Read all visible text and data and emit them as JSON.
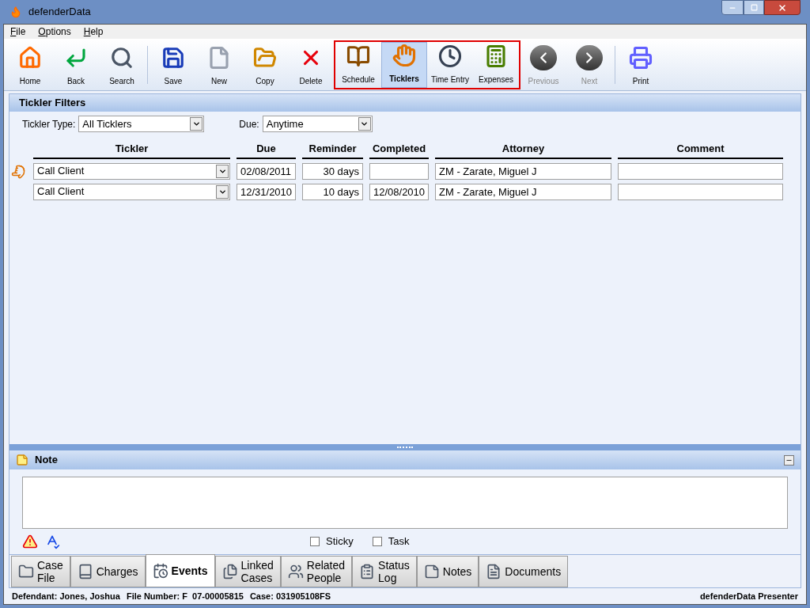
{
  "window": {
    "title": "defenderData"
  },
  "menu": [
    {
      "label": "File"
    },
    {
      "label": "Options"
    },
    {
      "label": "Help"
    }
  ],
  "toolbar": [
    {
      "highlighted": false,
      "divider_after": true,
      "buttons": [
        {
          "label": "Home",
          "selected": false,
          "disabled": false
        },
        {
          "label": "Back",
          "selected": false,
          "disabled": false
        },
        {
          "label": "Search",
          "selected": false,
          "disabled": false
        }
      ]
    },
    {
      "highlighted": false,
      "divider_after": false,
      "buttons": [
        {
          "label": "Save",
          "selected": false,
          "disabled": false
        },
        {
          "label": "New",
          "selected": false,
          "disabled": false
        },
        {
          "label": "Copy",
          "selected": false,
          "disabled": false
        },
        {
          "label": "Delete",
          "selected": false,
          "disabled": false
        }
      ]
    },
    {
      "highlighted": true,
      "divider_after": false,
      "buttons": [
        {
          "label": "Schedule",
          "selected": false,
          "disabled": false
        },
        {
          "label": "Ticklers",
          "selected": true,
          "disabled": false
        },
        {
          "label": "Time Entry",
          "selected": false,
          "disabled": false
        },
        {
          "label": "Expenses",
          "selected": false,
          "disabled": false
        }
      ]
    },
    {
      "highlighted": false,
      "divider_after": true,
      "buttons": [
        {
          "label": "Previous",
          "selected": false,
          "disabled": true
        },
        {
          "label": "Next",
          "selected": false,
          "disabled": true
        }
      ]
    },
    {
      "highlighted": false,
      "divider_after": false,
      "buttons": [
        {
          "label": "Print",
          "selected": false,
          "disabled": false
        }
      ]
    }
  ],
  "filters": {
    "title": "Tickler Filters",
    "fields": [
      {
        "label": "Tickler Type:",
        "value": "All Ticklers"
      },
      {
        "label": "Due:",
        "value": "Anytime"
      }
    ]
  },
  "table": {
    "columns": [
      "Tickler",
      "Due",
      "Reminder",
      "Completed",
      "Attorney",
      "Comment"
    ],
    "rows": [
      {
        "current": true,
        "cells": [
          "Call Client",
          "02/08/2011",
          "30 days",
          "",
          "ZM - Zarate, Miguel J",
          ""
        ]
      },
      {
        "current": false,
        "cells": [
          "Call Client",
          "12/31/2010",
          "10 days",
          "12/08/2010",
          "ZM - Zarate, Miguel J",
          ""
        ]
      }
    ]
  },
  "note": {
    "title": "Note",
    "options": [
      {
        "label": "Sticky",
        "checked": false
      },
      {
        "label": "Task",
        "checked": false
      }
    ]
  },
  "tabs": [
    {
      "label": "Case\nFile",
      "selected": false
    },
    {
      "label": "Charges",
      "selected": false
    },
    {
      "label": "Events",
      "selected": true
    },
    {
      "label": "Linked\nCases",
      "selected": false
    },
    {
      "label": "Related\nPeople",
      "selected": false
    },
    {
      "label": "Status\nLog",
      "selected": false
    },
    {
      "label": "Notes",
      "selected": false
    },
    {
      "label": "Documents",
      "selected": false
    }
  ],
  "status_bar": {
    "fields": [
      "Defendant: Jones, Joshua",
      "File Number: F  07-00005815",
      "Case: 031905108FS"
    ],
    "right": "defenderData Presenter"
  }
}
